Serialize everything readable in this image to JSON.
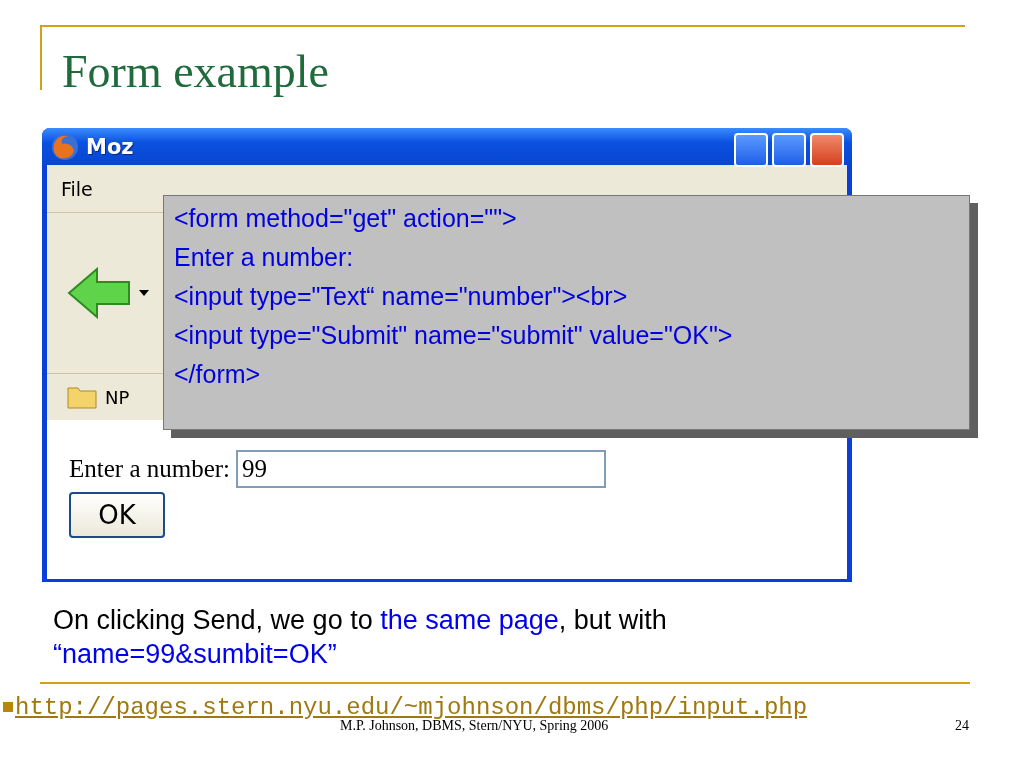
{
  "slide": {
    "title": "Form example"
  },
  "browser": {
    "title": "Moz",
    "menu": [
      "File"
    ],
    "bookmark": "NP",
    "form": {
      "label": "Enter a number:",
      "value": "99",
      "button": "OK"
    }
  },
  "code_callout": {
    "lines": [
      "<form method=\"get\" action=\"\">",
      "Enter a number:",
      "<input type=\"Text“ name=\"number\"><br>",
      "<input type=\"Submit\" name=\"submit\" value=\"OK\">",
      "</form>"
    ]
  },
  "caption": [
    {
      "text": "On clicking Send, we go to ",
      "kind": "plain"
    },
    {
      "text": "the same page",
      "kind": "highlight"
    },
    {
      "text": ", but with ",
      "kind": "plain"
    },
    {
      "text": "“name=99&sumbit=OK”",
      "kind": "highlight"
    }
  ],
  "link": "http://pages.stern.nyu.edu/~mjohnson/dbms/php/input.php",
  "footer": {
    "credit": "M.P. Johnson, DBMS, Stern/NYU, Spring 2006",
    "page": "24"
  }
}
